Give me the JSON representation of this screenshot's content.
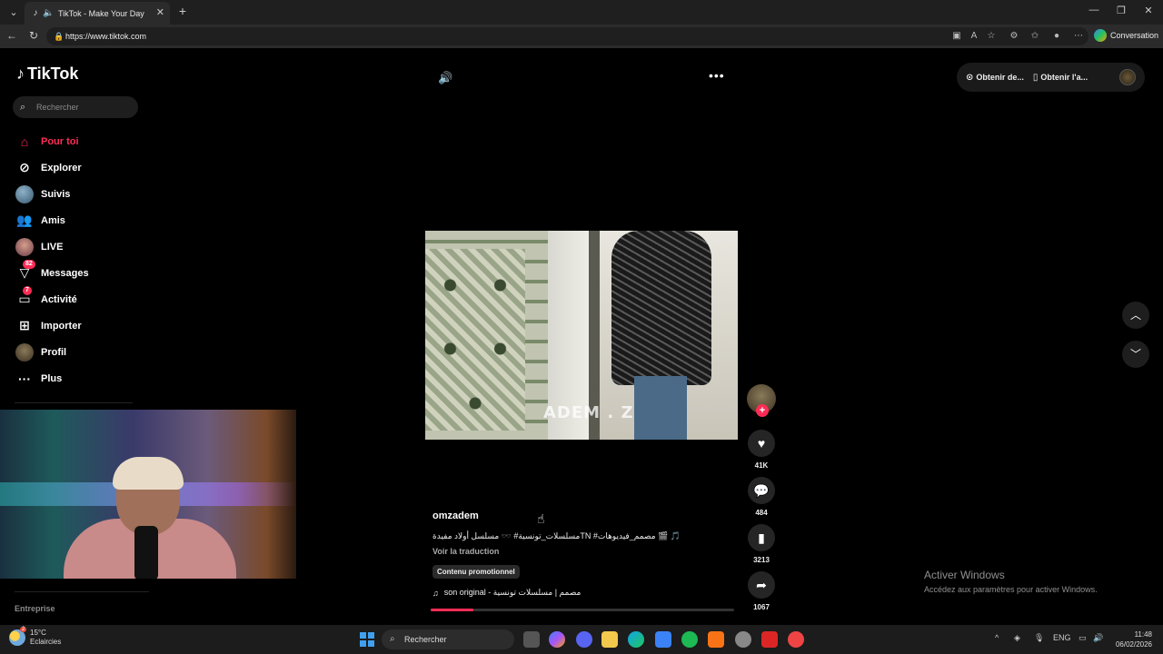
{
  "browser": {
    "tab_title": "TikTok - Make Your Day",
    "url": "https://www.tiktok.com",
    "copilot_label": "Conversation"
  },
  "sidebar": {
    "logo": "TikTok",
    "search_placeholder": "Rechercher",
    "items": [
      {
        "label": "Pour toi",
        "icon": "home-icon",
        "active": true
      },
      {
        "label": "Explorer",
        "icon": "compass-icon"
      },
      {
        "label": "Suivis",
        "icon": "following-avatar-icon"
      },
      {
        "label": "Amis",
        "icon": "friends-icon"
      },
      {
        "label": "LIVE",
        "icon": "live-avatar-icon"
      },
      {
        "label": "Messages",
        "icon": "messages-icon",
        "badge": "82"
      },
      {
        "label": "Activité",
        "icon": "activity-icon",
        "badge": "7"
      },
      {
        "label": "Importer",
        "icon": "upload-icon"
      },
      {
        "label": "Profil",
        "icon": "profile-avatar-icon"
      },
      {
        "label": "Plus",
        "icon": "more-icon"
      }
    ],
    "footer": "Entreprise"
  },
  "header": {
    "get_desktop": "Obtenir de...",
    "get_app": "Obtenir l'a..."
  },
  "video": {
    "watermark": "ADEM . Z",
    "author": "omzadem",
    "description": "🎵 🎬 مصمم_فيديوهات# TNمسلسلات_تونسية# 🕶️ مسلسل أولاد مفيدة",
    "translate": "Voir la traduction",
    "promo": "Contenu promotionnel",
    "music": "son original - مصمم | مسلسلات تونسية",
    "progress": 0.14,
    "likes": "41K",
    "comments": "484",
    "saves": "3213",
    "shares": "1067"
  },
  "watermark_windows": {
    "title": "Activer Windows",
    "subtitle": "Accédez aux paramètres pour activer Windows."
  },
  "taskbar": {
    "temp": "15°C",
    "weather": "Eclaircies",
    "weather_badge": "2",
    "search": "Rechercher",
    "lang": "ENG",
    "time": "11:48",
    "date": "06/02/2026"
  },
  "colors": {
    "accent": "#fe2c55",
    "background": "#000000"
  }
}
